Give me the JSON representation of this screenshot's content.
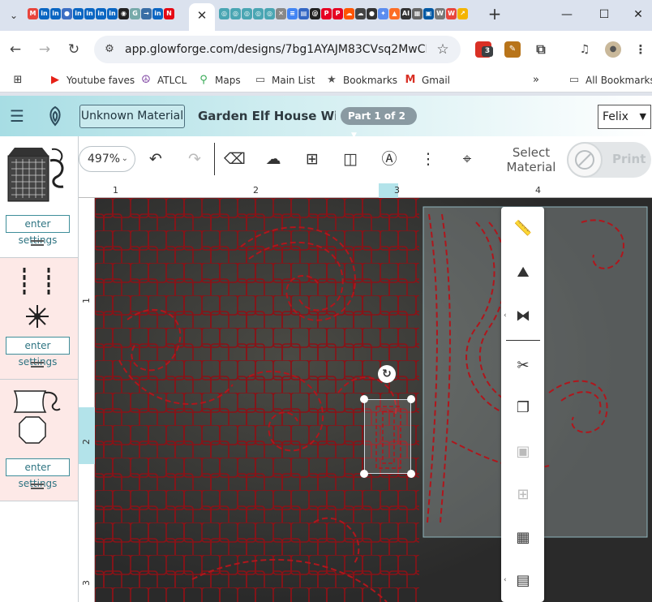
{
  "browser": {
    "close_tab_glyph": "✕",
    "new_tab_glyph": "+",
    "url": "app.glowforge.com/designs/7bg1AYAJM83CVsq2MwCMki...",
    "extension_badge": "3",
    "bookmarks": [
      {
        "label": "Youtube faves",
        "icon": "youtube-icon",
        "color": "#e62117"
      },
      {
        "label": "ATLCL",
        "icon": "peace-icon",
        "color": "#7b3fa0"
      },
      {
        "label": "Maps",
        "icon": "maps-pin-icon",
        "color": "#34a853"
      },
      {
        "label": "Main List",
        "icon": "folder-icon",
        "color": "#555555"
      },
      {
        "label": "Bookmarks",
        "icon": "star-icon",
        "color": "#555555"
      },
      {
        "label": "Gmail",
        "icon": "gmail-icon",
        "color": "#d93025"
      }
    ],
    "all_bookmarks_label": "All Bookmarks"
  },
  "app": {
    "material_button": "Unknown Material",
    "design_title": "Garden Elf House Wi...",
    "part_label": "Part 1 of 2",
    "user_name": "Felix",
    "zoom_level": "497%",
    "select_material_label": "Select Material",
    "print_label": "Print",
    "accent_color": "#3f8e9a",
    "cut_line_color": "#c0141a"
  },
  "sidebar": {
    "items": [
      {
        "settings_label": "enter settings",
        "bg": "#ffffff"
      },
      {
        "settings_label": "enter settings",
        "bg": "#fde9e7"
      },
      {
        "settings_label": "enter settings",
        "bg": "#fde9e7"
      }
    ]
  },
  "rulers": {
    "horizontal": [
      "1",
      "2",
      "3",
      "4"
    ],
    "vertical": [
      "1",
      "2",
      "3"
    ]
  }
}
